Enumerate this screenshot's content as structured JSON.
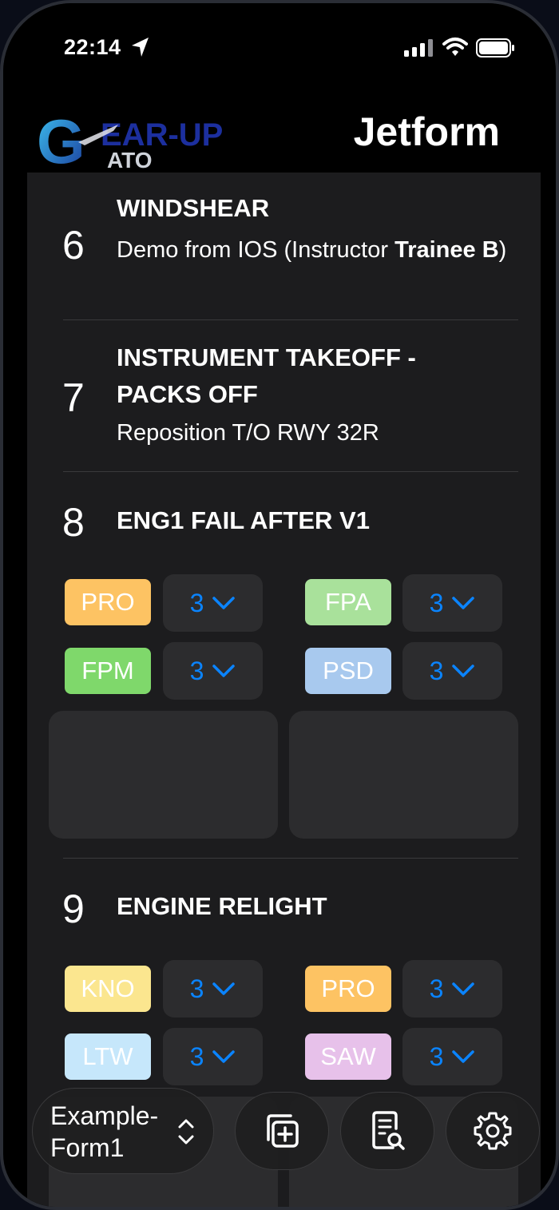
{
  "status_bar": {
    "time": "22:14"
  },
  "header": {
    "logo_text_1": "EAR-UP",
    "logo_text_2": "ATO",
    "logo_letter": "G",
    "title": "Jetform"
  },
  "items": [
    {
      "number": "6",
      "title": "WINDSHEAR",
      "subtitle_plain": "Demo from IOS (Instructor ",
      "subtitle_bold": "Trainee B",
      "subtitle_end": ")"
    },
    {
      "number": "7",
      "title": "INSTRUMENT TAKEOFF - PACKS OFF",
      "subtitle": "Reposition T/O RWY 32R"
    },
    {
      "number": "8",
      "title": "ENG1 FAIL AFTER V1",
      "grades": [
        {
          "code": "PRO",
          "value": "3",
          "color": "#fdc363"
        },
        {
          "code": "FPA",
          "value": "3",
          "color": "#a9e19b"
        },
        {
          "code": "FPM",
          "value": "3",
          "color": "#7fd86b"
        },
        {
          "code": "PSD",
          "value": "3",
          "color": "#a8c9ee"
        }
      ]
    },
    {
      "number": "9",
      "title": "ENGINE RELIGHT",
      "grades": [
        {
          "code": "KNO",
          "value": "3",
          "color": "#fbe68f"
        },
        {
          "code": "PRO",
          "value": "3",
          "color": "#fdc363"
        },
        {
          "code": "LTW",
          "value": "3",
          "color": "#c6e7fb"
        },
        {
          "code": "SAW",
          "value": "3",
          "color": "#e7c1ea"
        }
      ]
    }
  ],
  "toolbar": {
    "form_name": "Example-Form1",
    "icons": [
      "add-copy-icon",
      "document-search-icon",
      "gear-icon"
    ]
  },
  "colors": {
    "accent": "#0a84ff",
    "background": "#1c1c1e",
    "cell": "#2c2c2e"
  }
}
